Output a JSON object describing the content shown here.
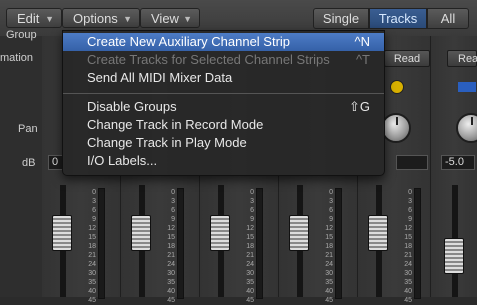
{
  "toolbar": {
    "edit": "Edit",
    "options": "Options",
    "view": "View",
    "single": "Single",
    "tracks": "Tracks",
    "all": "All"
  },
  "row_labels": {
    "group": "Group",
    "automation": "mation",
    "pan": "Pan",
    "db": "dB"
  },
  "strips": {
    "read": "Read",
    "read_partial": "Rea",
    "db_value_left": "0",
    "db_value_right": "-5.0",
    "scale": [
      "0",
      "3",
      "6",
      "9",
      "12",
      "15",
      "18",
      "21",
      "24",
      "30",
      "35",
      "40",
      "45"
    ]
  },
  "menu": {
    "items": [
      {
        "label": "Create New Auxiliary Channel Strip",
        "shortcut": "^N",
        "state": "highlighted"
      },
      {
        "label": "Create Tracks for Selected Channel Strips",
        "shortcut": "^T",
        "state": "disabled"
      },
      {
        "label": "Send All MIDI Mixer Data",
        "shortcut": "",
        "state": "normal"
      },
      {
        "label": "Disable Groups",
        "shortcut": "⇧G",
        "state": "normal"
      },
      {
        "label": "Change Track in Record Mode",
        "shortcut": "",
        "state": "normal"
      },
      {
        "label": "Change Track in Play Mode",
        "shortcut": "",
        "state": "normal"
      },
      {
        "label": "I/O Labels...",
        "shortcut": "",
        "state": "normal"
      }
    ]
  },
  "colors": {
    "accent": "#3a5e92",
    "highlight": "#4d7cc6"
  }
}
